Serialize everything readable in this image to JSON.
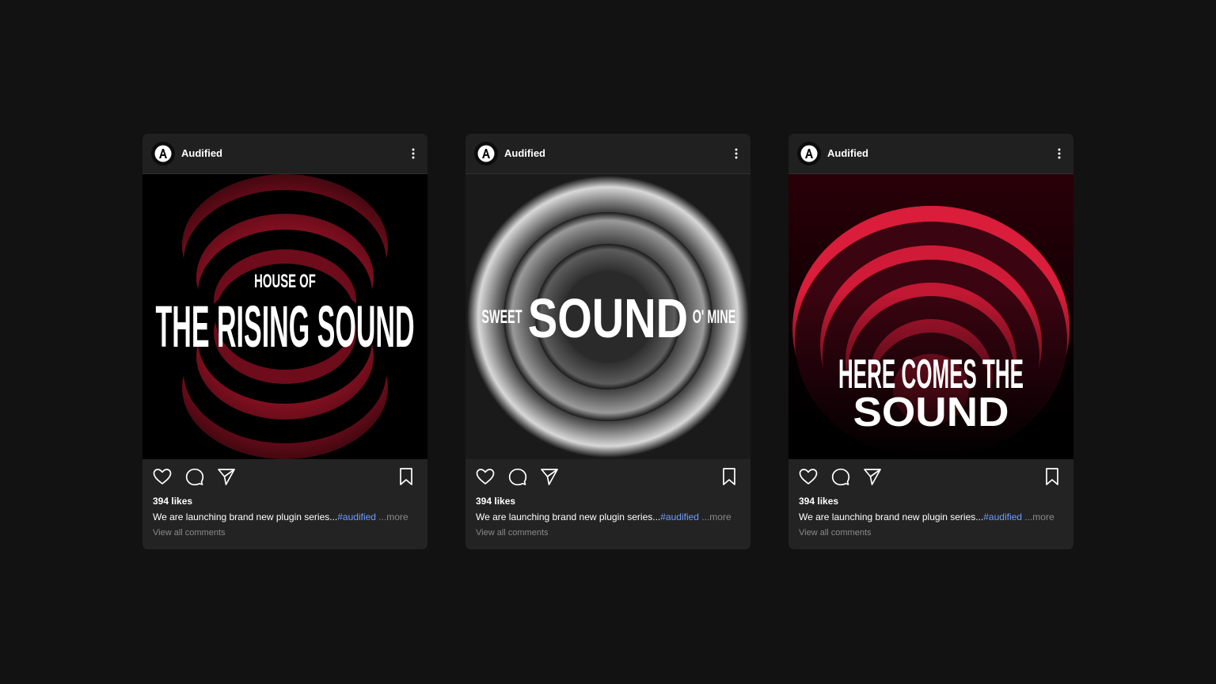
{
  "posts": [
    {
      "username": "Audified",
      "avatar_letter": "A",
      "image": {
        "kicker": "HOUSE OF",
        "title": "THE RISING SOUND"
      },
      "likes": "394 likes",
      "caption_text": "We are launching brand new plugin series...",
      "hashtag": "#audified",
      "more": " ...more",
      "view_comments": "View all comments"
    },
    {
      "username": "Audified",
      "avatar_letter": "A",
      "image": {
        "left": "SWEET",
        "title": "SOUND",
        "right": "O' MINE"
      },
      "likes": "394 likes",
      "caption_text": "We are launching brand new plugin series...",
      "hashtag": "#audified",
      "more": " ...more",
      "view_comments": "View all comments"
    },
    {
      "username": "Audified",
      "avatar_letter": "A",
      "image": {
        "line1": "HERE COMES THE",
        "title": "SOUND"
      },
      "likes": "394 likes",
      "caption_text": "We are launching brand new plugin series...",
      "hashtag": "#audified",
      "more": " ...more",
      "view_comments": "View all comments"
    }
  ],
  "colors": {
    "background": "#121212",
    "card": "#232323",
    "accent_red": "#e0203a",
    "hashtag": "#6d9dff",
    "muted": "#8a8a8a"
  },
  "icons": [
    "avatar-logo",
    "more-vertical-icon",
    "heart-icon",
    "comment-icon",
    "send-icon",
    "bookmark-icon"
  ]
}
